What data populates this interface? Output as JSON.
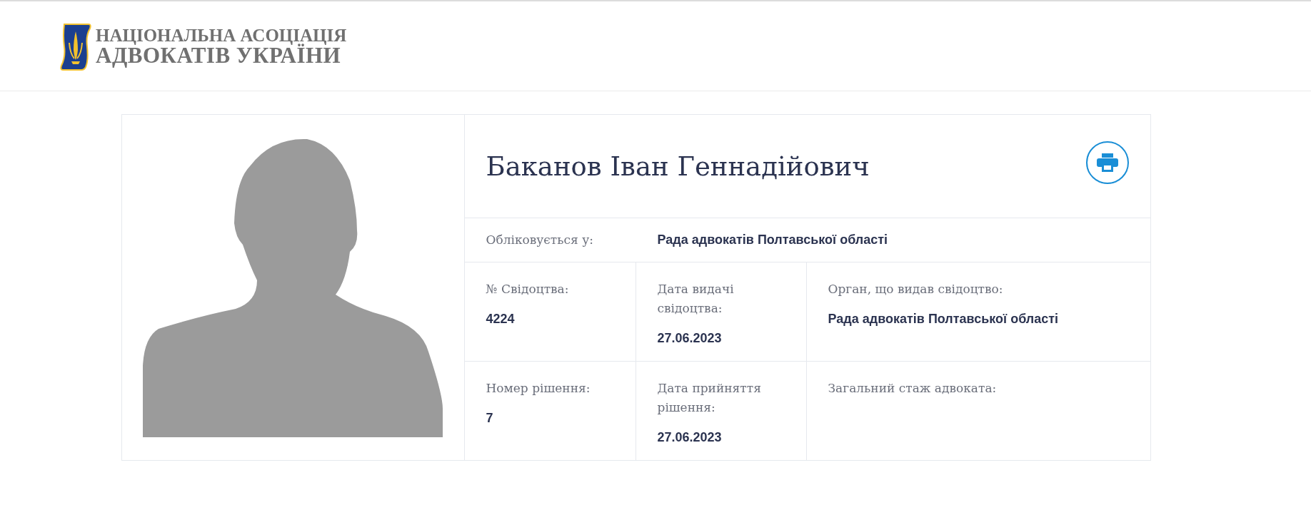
{
  "header": {
    "logo": {
      "line_1": "НАЦІОНАЛЬНА АСОЦІАЦІЯ",
      "line_2": "АДВОКАТІВ УКРАЇНИ"
    }
  },
  "profile": {
    "photo": {
      "kind": "placeholder"
    },
    "name": "Баканов Іван Геннадійович",
    "registered": {
      "label": "Обліковується у:",
      "value": "Рада адвокатів Полтавської області"
    },
    "rows": [
      [
        {
          "label": "№ Свідоцтва:",
          "value": "4224"
        },
        {
          "label": "Дата видачі свідоцтва:",
          "value": "27.06.2023"
        },
        {
          "label": "Орган, що видав свідоцтво:",
          "value": "Рада адвокатів Полтавської області"
        }
      ],
      [
        {
          "label": "Номер рішення:",
          "value": "7"
        },
        {
          "label": "Дата прийняття рішення:",
          "value": "27.06.2023"
        },
        {
          "label": "Загальний стаж адвоката:"
        }
      ]
    ]
  }
}
